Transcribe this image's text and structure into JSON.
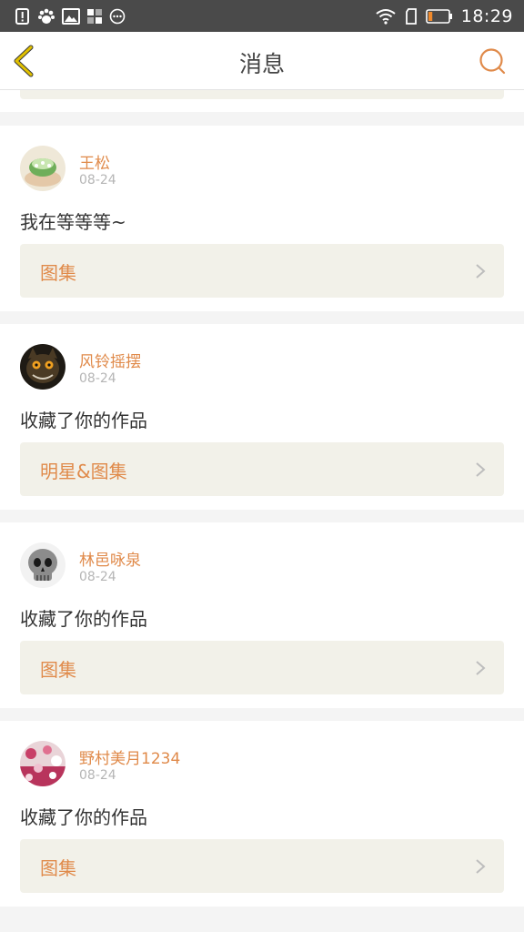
{
  "status_bar": {
    "time": "18:29",
    "battery_level": 0.2,
    "left_icons": [
      "alert-icon",
      "paw-icon",
      "image-icon",
      "grid-icon",
      "more-circle-icon"
    ],
    "right_icons": [
      "wifi-icon",
      "sim-icon",
      "battery-icon"
    ]
  },
  "nav": {
    "title": "消息",
    "back_icon": "chevron-left-icon",
    "search_icon": "search-icon",
    "accent_color": "#e08a4a",
    "back_color": "#c9a700"
  },
  "messages": [
    {
      "user": "王松",
      "date": "08-24",
      "text": "我在等等等~",
      "link": "图集",
      "avatar": "cake-avatar"
    },
    {
      "user": "风铃摇摆",
      "date": "08-24",
      "text": "收藏了你的作品",
      "link": "明星&图集",
      "avatar": "cat-avatar"
    },
    {
      "user": "林邑咏泉",
      "date": "08-24",
      "text": "收藏了你的作品",
      "link": "图集",
      "avatar": "skull-avatar"
    },
    {
      "user": "野村美月1234",
      "date": "08-24",
      "text": "收藏了你的作品",
      "link": "图集",
      "avatar": "floral-avatar"
    }
  ]
}
